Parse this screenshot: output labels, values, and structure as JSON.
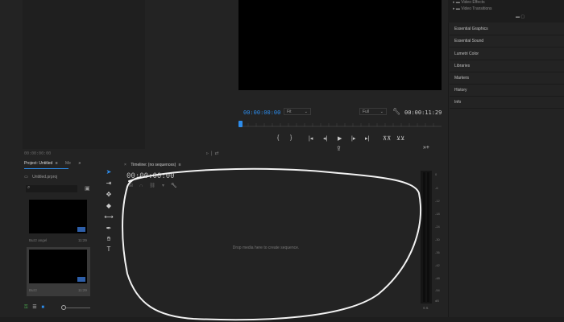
{
  "effects_tree": {
    "items": [
      {
        "label": "Video Effects"
      },
      {
        "label": "Video Transitions"
      }
    ]
  },
  "right_panel": {
    "items": [
      {
        "label": "Essential Graphics"
      },
      {
        "label": "Essential Sound"
      },
      {
        "label": "Lumetri Color"
      },
      {
        "label": "Libraries"
      },
      {
        "label": "Markers"
      },
      {
        "label": "History"
      },
      {
        "label": "Info"
      }
    ]
  },
  "source": {
    "timecode": "00:00:00:00"
  },
  "program": {
    "timecode": "00:00:00:00",
    "fit_option": "Fit",
    "quality_option": "Full",
    "duration": "00:00:11:29"
  },
  "project": {
    "tab_label": "Project: Untitled",
    "tab_menu": "≡",
    "other_tab": "Me",
    "more": "»",
    "file_name": "Untitled.prproj",
    "search_placeholder": "",
    "items": [
      {
        "name": "Buzz angel",
        "duration": "11:29"
      },
      {
        "name": "Buzz",
        "duration": "11:29"
      }
    ]
  },
  "timeline": {
    "tab_label": "Timeline: (no sequences)",
    "tab_menu": "≡",
    "timecode": "00:00:00:00",
    "drop_message": "Drop media here to create sequence."
  },
  "meters": {
    "scale": [
      "0",
      "-6",
      "-12",
      "-18",
      "-24",
      "-30",
      "-36",
      "-42",
      "-48",
      "-54",
      "dB"
    ],
    "solo": "S S"
  },
  "colors": {
    "accent": "#2d8ceb",
    "panel_bg": "#232323",
    "video_bg": "#000000"
  }
}
